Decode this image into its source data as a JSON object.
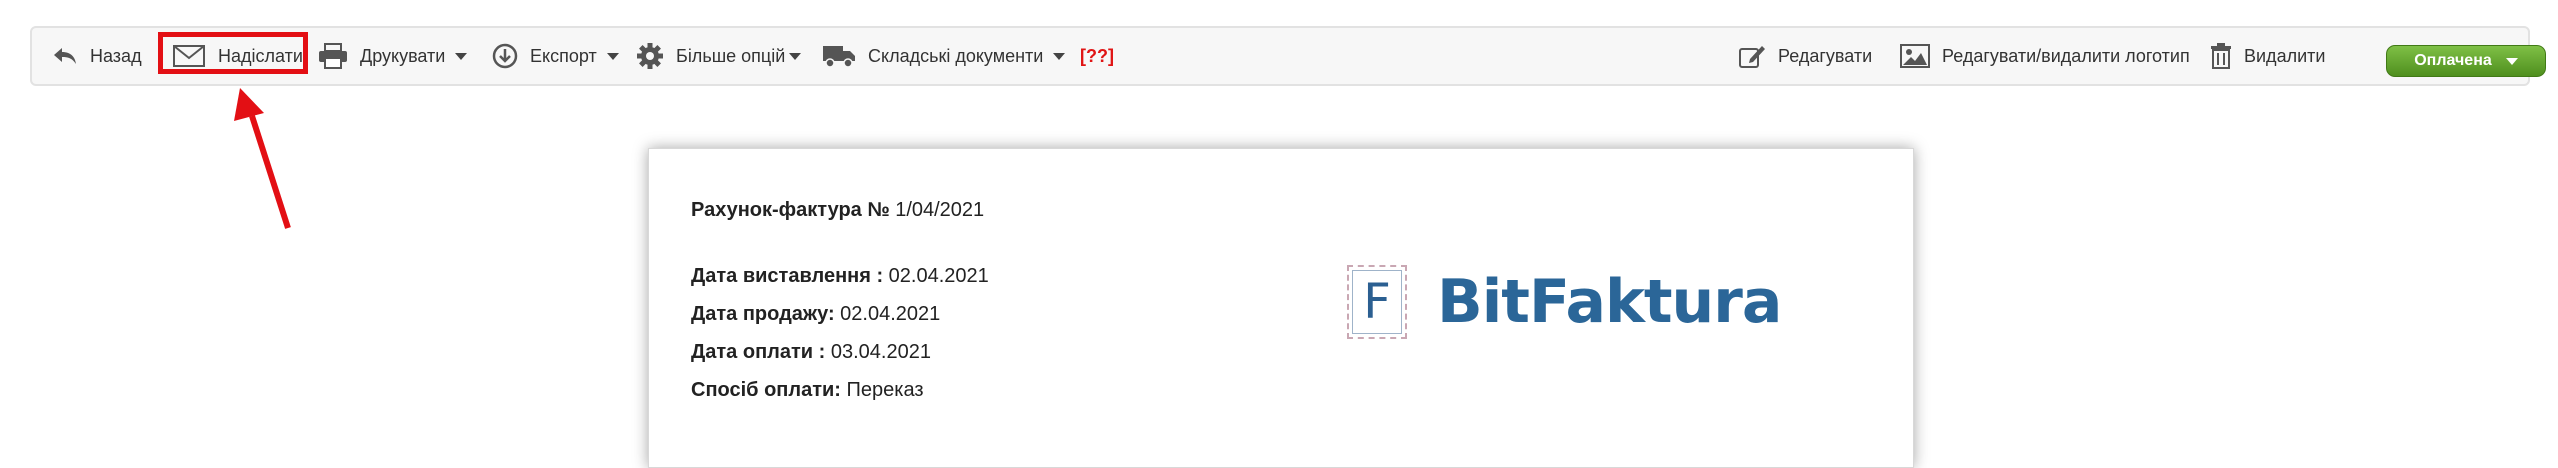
{
  "toolbar": {
    "back_label": "Назад",
    "send_label": "Надіслати",
    "print_label": "Друкувати",
    "export_label": "Експорт",
    "more_label": "Більше опцій",
    "warehouse_label": "Складські документи",
    "missing_label": "[??]",
    "edit_label": "Редагувати",
    "logo_label": "Редагувати/видалити логотип",
    "delete_label": "Видалити",
    "status_label": "Оплачена"
  },
  "document": {
    "title_label": "Рахунок-фактура №",
    "title_value": " 1/04/2021",
    "issue_label": "Дата виставлення :",
    "issue_value": " 02.04.2021",
    "sale_label": "Дата продажу:",
    "sale_value": " 02.04.2021",
    "payment_label": "Дата оплати :",
    "payment_value": " 03.04.2021",
    "method_label": "Спосіб оплати:",
    "method_value": " Переказ",
    "logo_letter": "F",
    "logo_text": "BitFaktura"
  },
  "colors": {
    "highlight": "#e30f14",
    "status_green": "#5fa22c",
    "logo_blue": "#2b6698",
    "missing_red": "#e01515"
  }
}
